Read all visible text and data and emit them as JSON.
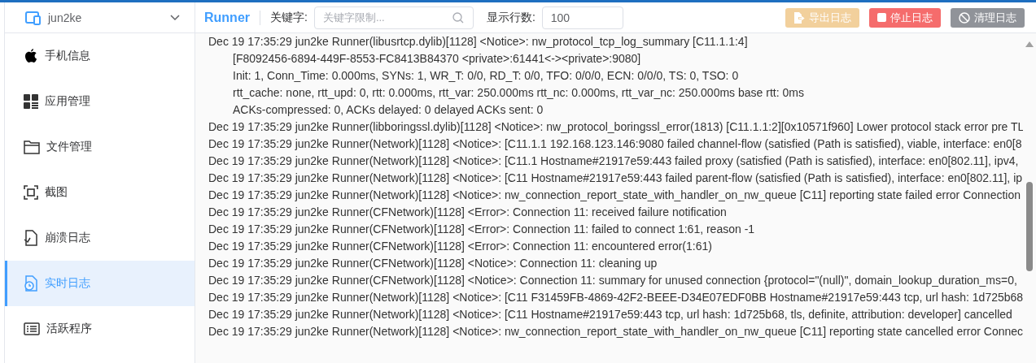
{
  "device": {
    "name": "jun2ke"
  },
  "sidebar": {
    "items": [
      {
        "label": "手机信息",
        "selected": false
      },
      {
        "label": "应用管理",
        "selected": false
      },
      {
        "label": "文件管理",
        "selected": false
      },
      {
        "label": "截图",
        "selected": false
      },
      {
        "label": "崩溃日志",
        "selected": false
      },
      {
        "label": "实时日志",
        "selected": true
      },
      {
        "label": "活跃程序",
        "selected": false
      }
    ]
  },
  "toolbar": {
    "app": "Runner",
    "keyword_label": "关键字:",
    "keyword": {
      "placeholder": "关键字限制..."
    },
    "rows_label": "显示行数:",
    "rows": {
      "value": "100"
    },
    "buttons": [
      {
        "label": "导出日志",
        "kind": "export",
        "disabled": true
      },
      {
        "label": "停止日志",
        "kind": "stop",
        "disabled": false
      },
      {
        "label": "清理日志",
        "kind": "clear",
        "disabled": false
      }
    ]
  },
  "log": [
    {
      "text": "Dec 19 17:35:29 jun2ke Runner(libusrtcp.dylib)[1128] <Notice>: nw_protocol_tcp_log_summary [C11.1.1:4]",
      "details": [
        "[F8092456-6894-449F-8553-FC8413B84370 <private>:61441<-><private>:9080]",
        "Init: 1, Conn_Time: 0.000ms, SYNs: 1, WR_T: 0/0, RD_T: 0/0, TFO: 0/0/0, ECN: 0/0/0, TS: 0, TSO: 0",
        "rtt_cache: none, rtt_upd: 0, rtt: 0.000ms, rtt_var: 250.000ms rtt_nc: 0.000ms, rtt_var_nc: 250.000ms base rtt: 0ms",
        "ACKs-compressed: 0, ACKs delayed: 0 delayed ACKs sent: 0"
      ]
    },
    {
      "text": "Dec 19 17:35:29 jun2ke Runner(libboringssl.dylib)[1128] <Notice>: nw_protocol_boringssl_error(1813) [C11.1.1:2][0x10571f960] Lower protocol stack error pre TL"
    },
    {
      "text": "Dec 19 17:35:29 jun2ke Runner(Network)[1128] <Notice>: [C11.1.1 192.168.123.146:9080 failed channel-flow (satisfied (Path is satisfied), viable, interface: en0[8"
    },
    {
      "text": "Dec 19 17:35:29 jun2ke Runner(Network)[1128] <Notice>: [C11.1 Hostname#21917e59:443 failed proxy (satisfied (Path is satisfied), interface: en0[802.11], ipv4,"
    },
    {
      "text": "Dec 19 17:35:29 jun2ke Runner(Network)[1128] <Notice>: [C11 Hostname#21917e59:443 failed parent-flow (satisfied (Path is satisfied), interface: en0[802.11], ip"
    },
    {
      "text": "Dec 19 17:35:29 jun2ke Runner(Network)[1128] <Notice>: nw_connection_report_state_with_handler_on_nw_queue [C11] reporting state failed error Connection"
    },
    {
      "text": "Dec 19 17:35:29 jun2ke Runner(CFNetwork)[1128] <Error>: Connection 11: received failure notification"
    },
    {
      "text": "Dec 19 17:35:29 jun2ke Runner(CFNetwork)[1128] <Error>: Connection 11: failed to connect 1:61, reason -1"
    },
    {
      "text": "Dec 19 17:35:29 jun2ke Runner(CFNetwork)[1128] <Error>: Connection 11: encountered error(1:61)"
    },
    {
      "text": "Dec 19 17:35:29 jun2ke Runner(CFNetwork)[1128] <Notice>: Connection 11: cleaning up"
    },
    {
      "text": "Dec 19 17:35:29 jun2ke Runner(CFNetwork)[1128] <Notice>: Connection 11: summary for unused connection {protocol=\"(null)\", domain_lookup_duration_ms=0,"
    },
    {
      "text": "Dec 19 17:35:29 jun2ke Runner(Network)[1128] <Notice>: [C11 F31459FB-4869-42F2-BEEE-D34E07EDF0BB Hostname#21917e59:443 tcp, url hash: 1d725b68"
    },
    {
      "text": "Dec 19 17:35:29 jun2ke Runner(Network)[1128] <Notice>: [C11 Hostname#21917e59:443 tcp, url hash: 1d725b68, tls, definite, attribution: developer] cancelled"
    },
    {
      "text": "Dec 19 17:35:29 jun2ke Runner(Network)[1128] <Notice>: nw_connection_report_state_with_handler_on_nw_queue [C11] reporting state cancelled error Connec"
    }
  ]
}
